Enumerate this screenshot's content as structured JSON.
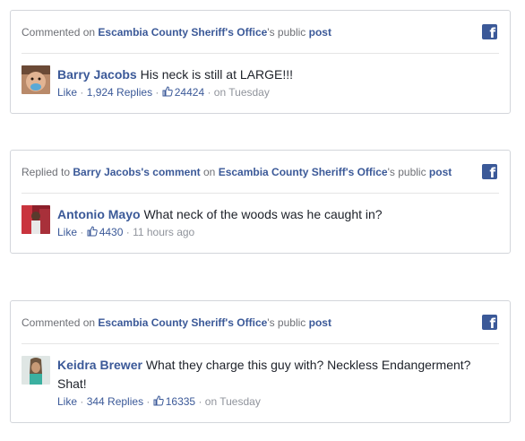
{
  "cards": [
    {
      "header": {
        "action": "Commented on",
        "page": "Escambia County Sheriff's Office",
        "suffix": "'s public",
        "post": "post"
      },
      "comment": {
        "author": "Barry Jacobs",
        "text": "His neck is still at LARGE!!!",
        "like": "Like",
        "replies": "1,924 Replies",
        "reactions": "24424",
        "time": "on Tuesday"
      }
    },
    {
      "header": {
        "action": "Replied to",
        "comment_author": "Barry Jacobs's comment",
        "on": "on",
        "page": "Escambia County Sheriff's Office",
        "suffix": "'s public",
        "post": "post"
      },
      "comment": {
        "author": "Antonio Mayo",
        "text": "What neck of the woods was he caught in?",
        "like": "Like",
        "reactions": "4430",
        "time": "11 hours ago"
      }
    },
    {
      "header": {
        "action": "Commented on",
        "page": "Escambia County Sheriff's Office",
        "suffix": "'s public",
        "post": "post"
      },
      "comment": {
        "author": "Keidra Brewer",
        "text": "What they charge this guy with? Neckless Endangerment? Shat!",
        "like": "Like",
        "replies": "344 Replies",
        "reactions": "16335",
        "time": "on Tuesday"
      }
    }
  ],
  "icons": {
    "brand": "facebook-icon",
    "reaction": "thumbs-up-icon"
  },
  "colors": {
    "link": "#3b5998",
    "meta": "#90949c",
    "border": "#d3d6db"
  }
}
